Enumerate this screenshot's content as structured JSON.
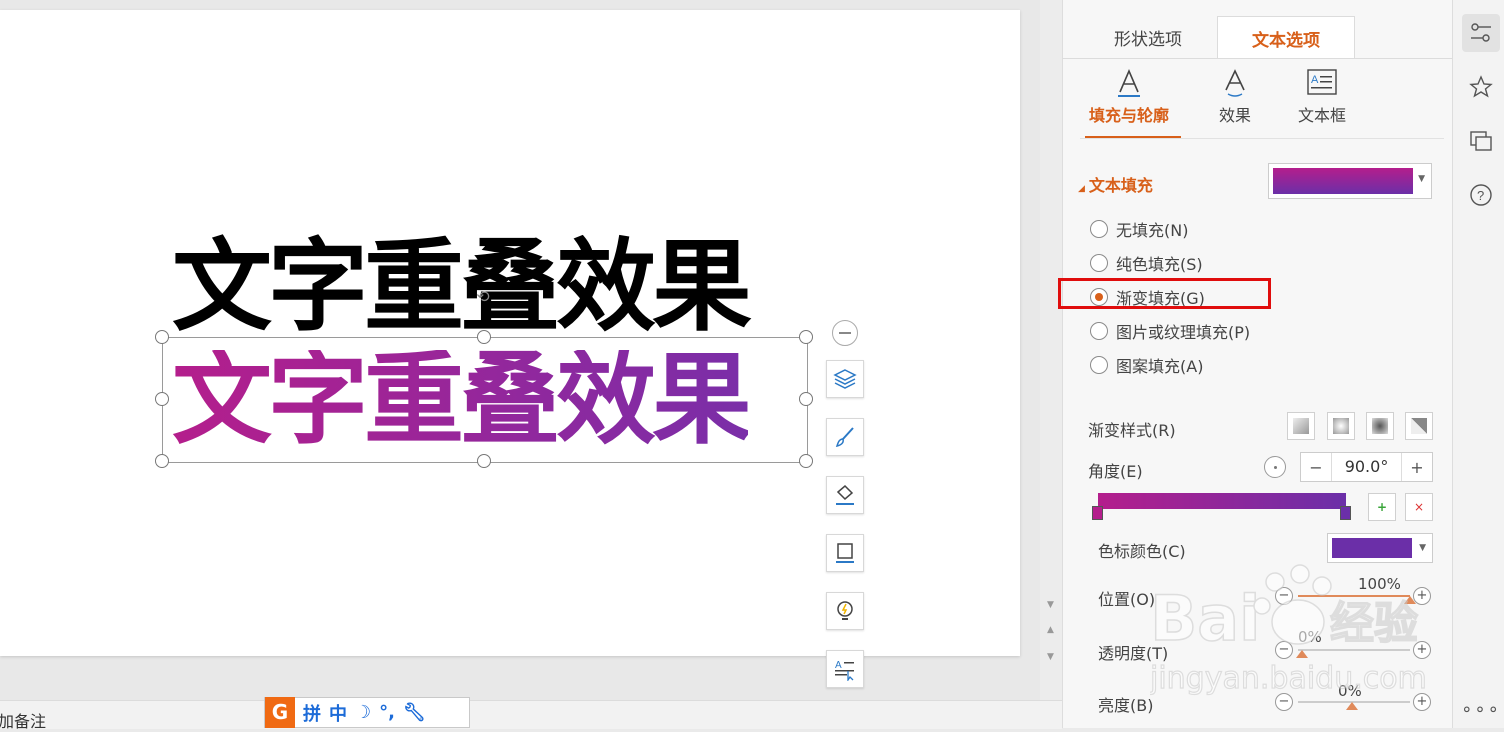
{
  "slide": {
    "line1": "文字重叠效果",
    "line2": "文字重叠效果"
  },
  "bottom": {
    "notes": "加备注",
    "ime": [
      "拼",
      "中"
    ]
  },
  "panel": {
    "tabs": [
      "形状选项",
      "文本选项"
    ],
    "subtabs": [
      "填充与轮廓",
      "效果",
      "文本框"
    ],
    "section": "文本填充",
    "fill_options": [
      {
        "label": "无填充(N)",
        "checked": false
      },
      {
        "label": "纯色填充(S)",
        "checked": false
      },
      {
        "label": "渐变填充(G)",
        "checked": true
      },
      {
        "label": "图片或纹理填充(P)",
        "checked": false
      },
      {
        "label": "图案填充(A)",
        "checked": false
      }
    ],
    "gradient_style_label": "渐变样式(R)",
    "angle_label": "角度(E)",
    "angle_value": "90.0°",
    "stop_color_label": "色标颜色(C)",
    "position_label": "位置(O)",
    "position_value": "100%",
    "position_level": 1.0,
    "transparency_label": "透明度(T)",
    "transparency_value": "0%",
    "brightness_label": "亮度(B)",
    "brightness_value": "0%"
  },
  "colors": {
    "accent": "#d8601a",
    "gradient_start": "#b41e8c",
    "gradient_end": "#6b2fa8",
    "highlight": "#e00d0d"
  },
  "watermark": {
    "brand": "Bai",
    "brand_cn": "经验",
    "url": "jingyan.baidu.com"
  }
}
